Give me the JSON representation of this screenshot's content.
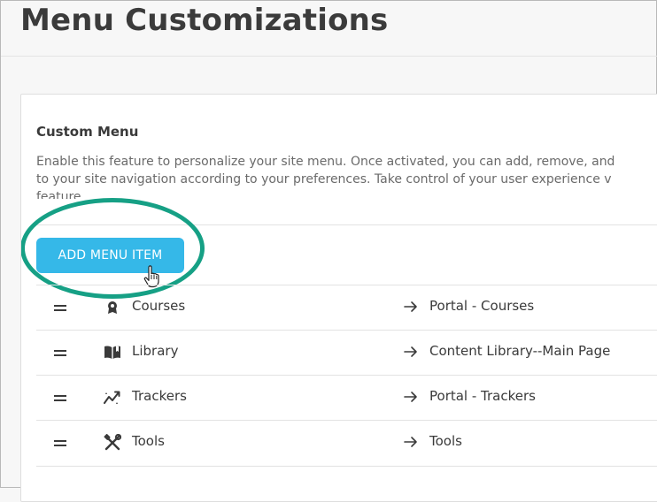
{
  "page": {
    "title": "Menu Customizations"
  },
  "custom_menu": {
    "heading": "Custom Menu",
    "description_lines": [
      "Enable this feature to personalize your site menu. Once activated, you can add, remove, and",
      "to your site navigation according to your preferences. Take control of your user experience v",
      "feature."
    ],
    "add_button_label": "ADD MENU ITEM",
    "highlight_color": "#16a085",
    "button_color": "#35b8e8"
  },
  "menu_items": [
    {
      "label": "Courses",
      "icon": "graduation-icon",
      "target": "Portal - Courses"
    },
    {
      "label": "Library",
      "icon": "book-icon",
      "target": "Content Library--Main Page"
    },
    {
      "label": "Trackers",
      "icon": "trend-icon",
      "target": "Portal - Trackers"
    },
    {
      "label": "Tools",
      "icon": "tools-icon",
      "target": "Tools"
    }
  ]
}
